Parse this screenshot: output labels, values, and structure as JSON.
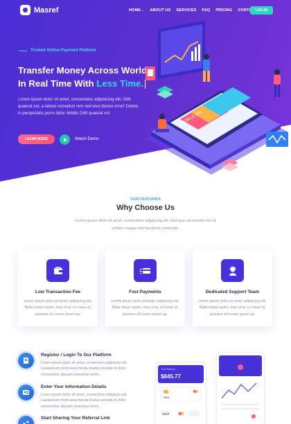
{
  "brand": {
    "name": "Masref"
  },
  "nav": {
    "items": [
      {
        "label": "HOME"
      },
      {
        "label": "ABOUT US"
      },
      {
        "label": "SERVICES"
      },
      {
        "label": "FAQ"
      },
      {
        "label": "PRICING"
      },
      {
        "label": "CONTACT"
      }
    ],
    "login_label": "LOG IN"
  },
  "hero": {
    "tagline": "Trusted Online Payment Platform",
    "title_line1": "Transfer Money Across World",
    "title_line2_prefix": "In Real Time With ",
    "title_accent": "Less Time.",
    "description": "Lorem ipsum dolor sit amet, consectetur adipisicing elit. Odit quaerat est, a labore excepturi rem sed eius facere error! Dolore in perspiciatis porro dolor debitis Odit quaerat est",
    "learn_more_label": "LEARN MORE",
    "watch_label": "Watch Demo",
    "illustration_text": {
      "card_label": "MOBILE PAY"
    }
  },
  "features": {
    "eyebrow": "OUR FEATURES",
    "title": "Why Choose Us",
    "subtitle": "Lorem ipsum dolor sit amet, consectetur adipiscing elit. Sed quis accumsan nisi Ut ut felis congue nisl hendrerit commodo.",
    "cards": [
      {
        "title": "Low Transaction Fee",
        "text": "Lorem ipsum dolor sit amet, adipiscing elit. Nulla neque quam, max ut ac cu msan ut, posuere sit Lorem ipsum qu.",
        "icon": "wallet-icon"
      },
      {
        "title": "Fast Payments",
        "text": "Lorem ipsum dolor sit amet, adipiscing elit. Nulla neque quam, max ut ac cu msan ut, posuere sit Lorem ipsum qu.",
        "icon": "fast-card-icon"
      },
      {
        "title": "Dedicated Support Team",
        "text": "Lorem ipsum dolor sit amet, adipiscing elit. Nulla neque quam, max ut ac cu msan ut, posuere sit Lorem ipsum qu.",
        "icon": "support-agent-icon"
      }
    ]
  },
  "steps": [
    {
      "title": "Registor / Login To Our Platform",
      "text": "Lorem ipsum dolor sit amet, consectetur adipisicin elit. Laudantium modi assumenda beatae provide nt dolor consectetur aliquam possimus tortor..",
      "icon": "register-icon"
    },
    {
      "title": "Enter Your Information Details",
      "text": "Lorem ipsum dolor sit amet, consectetur adipisicin elit. Laudantium modi assumenda beatae provide nt dolor consectetur aliquam possimus tortor..",
      "icon": "information-icon"
    },
    {
      "title": "Start Sharing Your Referral Link",
      "text": "",
      "icon": "share-icon"
    }
  ],
  "phone_mockup": {
    "balance_label": "Your Balance",
    "balance": "$845.77",
    "card_last": "0264",
    "brand_visa": "VISA"
  },
  "colors": {
    "primary": "#4a2fd6",
    "accent_teal": "#2fd8c2",
    "accent_pink": "#ff4f7a",
    "text_dark": "#2b2d42",
    "muted": "#8a8da0"
  }
}
